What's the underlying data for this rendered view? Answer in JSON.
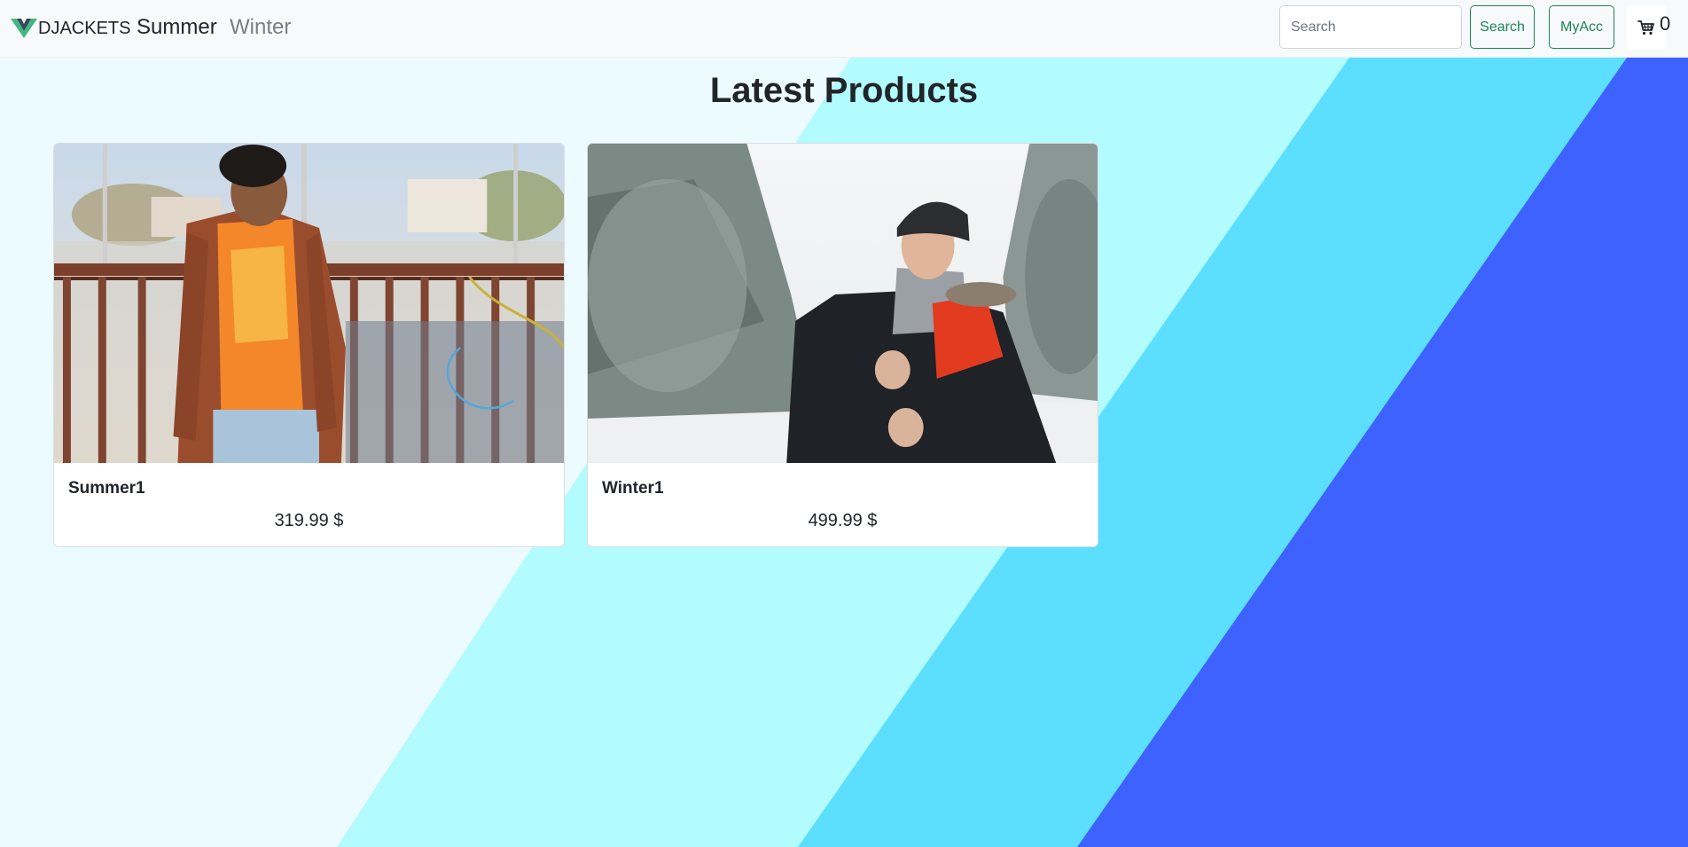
{
  "navbar": {
    "brand": "DJACKETS",
    "links": [
      {
        "label": "Summer",
        "active": true
      },
      {
        "label": "Winter",
        "active": false
      }
    ],
    "search_placeholder": "Search",
    "search_button": "Search",
    "account_button": "MyAcc",
    "cart_icon": "cart-icon",
    "cart_count": "0"
  },
  "main": {
    "heading": "Latest Products",
    "products": [
      {
        "name": "Summer1",
        "price": "319.99 $",
        "image": "man in brown leather jacket on rooftop railing"
      },
      {
        "name": "Winter1",
        "price": "499.99 $",
        "image": "man in black winter parka in snowy forest"
      }
    ]
  },
  "colors": {
    "accent": "#198754",
    "bg_light": "#ecfbff",
    "stripe_aqua": "#b2fbff",
    "stripe_cyan": "#5cdfff",
    "stripe_blue": "#3e62ff"
  }
}
